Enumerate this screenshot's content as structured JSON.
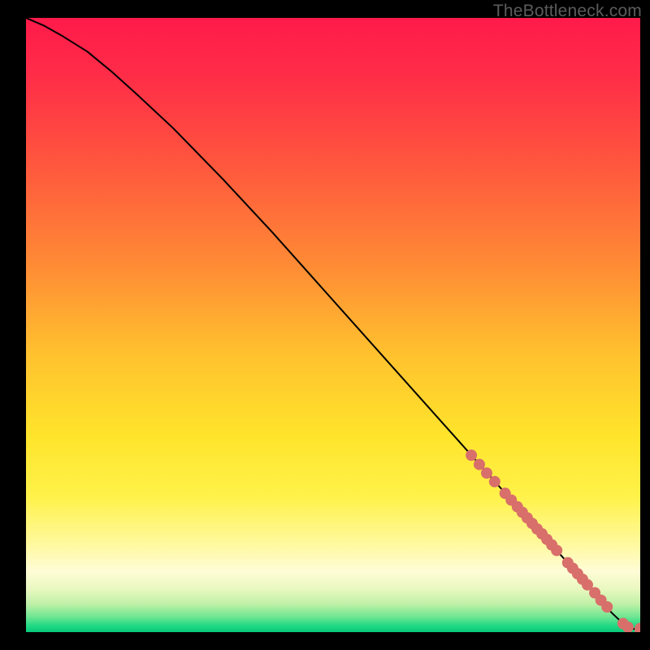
{
  "watermark": "TheBottleneck.com",
  "chart_data": {
    "type": "line",
    "title": "",
    "xlabel": "",
    "ylabel": "",
    "xlim": [
      0,
      100
    ],
    "ylim": [
      0,
      100
    ],
    "gradient_stops": [
      {
        "offset": 0.0,
        "color": "#ff1a4a"
      },
      {
        "offset": 0.1,
        "color": "#ff2e47"
      },
      {
        "offset": 0.25,
        "color": "#ff5a3d"
      },
      {
        "offset": 0.4,
        "color": "#ff8a35"
      },
      {
        "offset": 0.55,
        "color": "#ffc22e"
      },
      {
        "offset": 0.68,
        "color": "#ffe42b"
      },
      {
        "offset": 0.78,
        "color": "#fff24a"
      },
      {
        "offset": 0.86,
        "color": "#fff9a2"
      },
      {
        "offset": 0.9,
        "color": "#fffcd6"
      },
      {
        "offset": 0.93,
        "color": "#e9f8c0"
      },
      {
        "offset": 0.955,
        "color": "#bdf0a6"
      },
      {
        "offset": 0.975,
        "color": "#6fe693"
      },
      {
        "offset": 0.99,
        "color": "#1fd884"
      },
      {
        "offset": 1.0,
        "color": "#07c97a"
      }
    ],
    "series": [
      {
        "name": "curve",
        "type": "line",
        "color": "#000000",
        "width": 2,
        "x": [
          0,
          3,
          6,
          10,
          14,
          18,
          24,
          32,
          40,
          50,
          60,
          70,
          80,
          88,
          92,
          94,
          95.5,
          97,
          98.5,
          100
        ],
        "y": [
          100,
          98.7,
          97.0,
          94.5,
          91.2,
          87.6,
          82.0,
          73.8,
          65.2,
          54.0,
          42.8,
          31.6,
          20.4,
          11.5,
          7.0,
          4.6,
          3.0,
          1.6,
          0.6,
          0.4
        ]
      },
      {
        "name": "markers",
        "type": "scatter",
        "color": "#d86f6a",
        "radius": 7,
        "x": [
          72.5,
          73.8,
          75.0,
          76.3,
          78.0,
          79.0,
          80.0,
          80.8,
          81.6,
          82.4,
          83.2,
          84.0,
          84.8,
          85.6,
          86.4,
          88.2,
          89.0,
          89.8,
          90.6,
          91.4,
          92.6,
          93.6,
          94.6,
          97.2,
          98.0,
          100.0,
          100.0
        ],
        "y": [
          28.8,
          27.3,
          25.9,
          24.5,
          22.6,
          21.5,
          20.4,
          19.5,
          18.6,
          17.7,
          16.8,
          16.0,
          15.1,
          14.2,
          13.3,
          11.3,
          10.4,
          9.5,
          8.6,
          7.7,
          6.4,
          5.2,
          4.1,
          1.4,
          0.8,
          0.6,
          0.2
        ]
      }
    ]
  }
}
